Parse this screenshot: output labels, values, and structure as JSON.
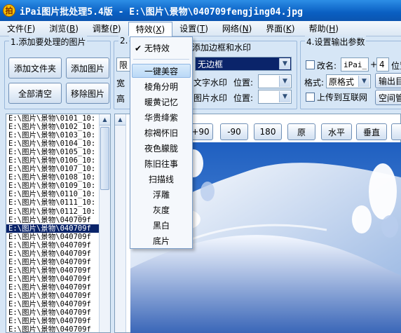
{
  "window": {
    "title": "iPai图片批处理5.4版 - E:\\图片\\景物\\040709fengjing04.jpg",
    "icon_char": "拍"
  },
  "menu": [
    {
      "label": "文件",
      "key": "F"
    },
    {
      "label": "浏览",
      "key": "B"
    },
    {
      "label": "调整",
      "key": "P"
    },
    {
      "label": "特效",
      "key": "X"
    },
    {
      "label": "设置",
      "key": "T"
    },
    {
      "label": "网络",
      "key": "N"
    },
    {
      "label": "界面",
      "key": "K"
    },
    {
      "label": "帮助",
      "key": "H"
    }
  ],
  "group1": {
    "title": "1.添加要处理的图片",
    "add_folder": "添加文件夹",
    "add_image": "添加图片",
    "clear_all": "全部清空",
    "remove_image": "移除图片"
  },
  "group2": {
    "title": "2.",
    "combo1_value": "限",
    "width_label": "宽",
    "height_label": "高"
  },
  "group3": {
    "title": "添加边框和水印",
    "border_value": "无边框",
    "text_watermark": "文字水印",
    "image_watermark": "图片水印",
    "position1": "位置:",
    "position2": "位置:"
  },
  "group4": {
    "title": "4.设置输出参数",
    "rename_label": "改名:",
    "rename_prefix": "iPai_",
    "plus": "+",
    "rename_digits": "4",
    "position_label": "位置",
    "format_label": "格式:",
    "format_value": "原格式",
    "output_dir_button": "输出目",
    "upload_label": "上传到互联网",
    "space_button": "空间管"
  },
  "toolbar": {
    "rot_plus90": "+90",
    "rot_minus90": "-90",
    "rot_180": "180",
    "original": "原",
    "flip_h": "水平",
    "flip_v": "垂直"
  },
  "effects_menu": {
    "items": [
      "无特效",
      "一键美容",
      "棱角分明",
      "暖黄记忆",
      "华贵绛紫",
      "棕褐怀旧",
      "夜色朦胧",
      "陈旧往事",
      "扫描线",
      "浮雕",
      "灰度",
      "黑白",
      "底片"
    ],
    "checked": "无特效",
    "highlighted": "一键美容"
  },
  "file_list": [
    "E:\\图片\\景物\\0101_10:",
    "E:\\图片\\景物\\0102_10:",
    "E:\\图片\\景物\\0103_10:",
    "E:\\图片\\景物\\0104_10:",
    "E:\\图片\\景物\\0105_10:",
    "E:\\图片\\景物\\0106_10:",
    "E:\\图片\\景物\\0107_10:",
    "E:\\图片\\景物\\0108_10:",
    "E:\\图片\\景物\\0109_10:",
    "E:\\图片\\景物\\0110_10:",
    "E:\\图片\\景物\\0111_10:",
    "E:\\图片\\景物\\0112_10:",
    "E:\\图片\\景物\\040709f",
    "E:\\图片\\景物\\040709f",
    "E:\\图片\\景物\\040709f",
    "E:\\图片\\景物\\040709f",
    "E:\\图片\\景物\\040709f",
    "E:\\图片\\景物\\040709f",
    "E:\\图片\\景物\\040709f",
    "E:\\图片\\景物\\040709f",
    "E:\\图片\\景物\\040709f",
    "E:\\图片\\景物\\040709f",
    "E:\\图片\\景物\\040709f",
    "E:\\图片\\景物\\040709f",
    "E:\\图片\\景物\\040709f",
    "E:\\图片\\景物\\040709f"
  ],
  "selected_file_index": 13,
  "colors": {
    "titlebar": "#0a5fc2",
    "selection": "#0a246a",
    "background": "#d6e6f6"
  }
}
